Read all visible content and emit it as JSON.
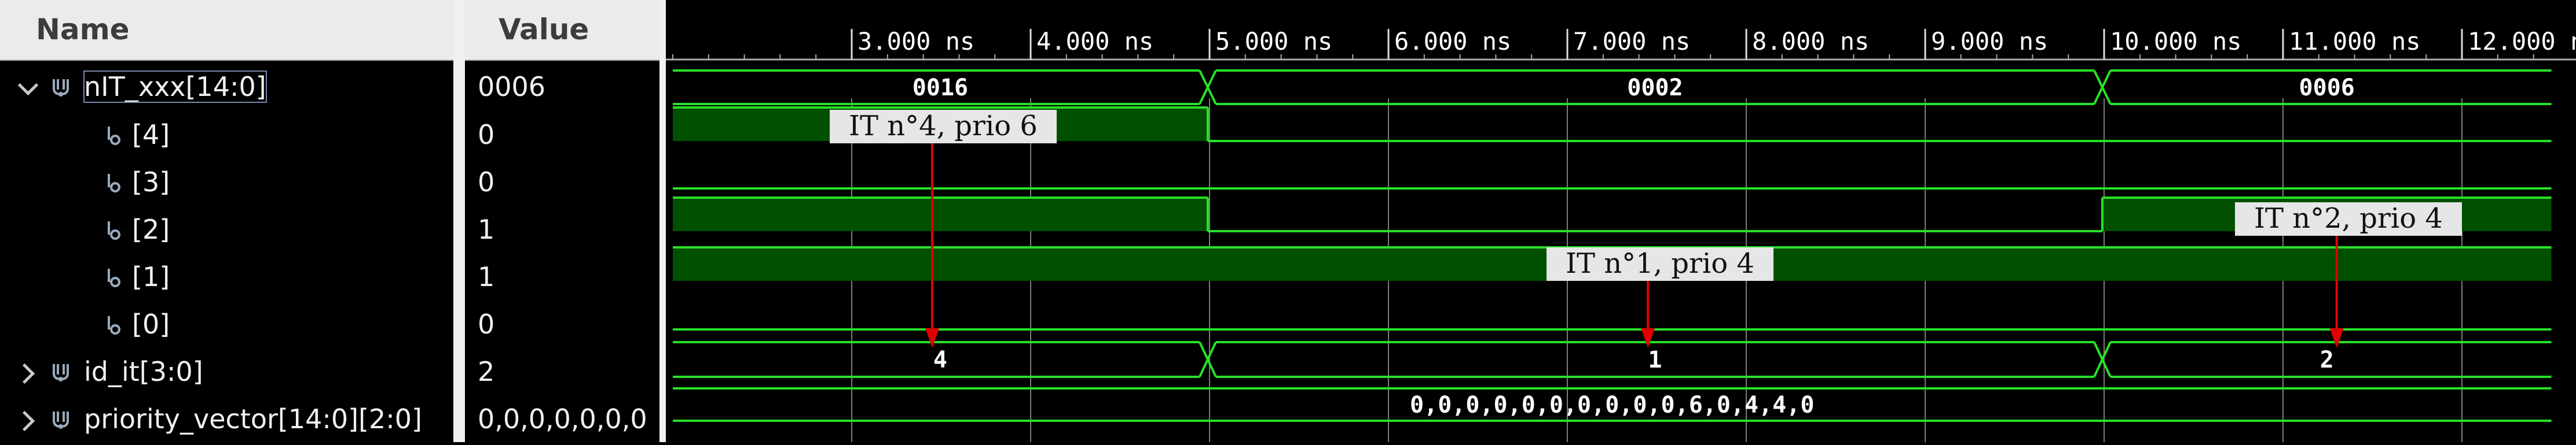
{
  "names_panel": {
    "header": "Name",
    "rows": [
      {
        "label": "nIT_xxx[14:0]",
        "expander": "expanded",
        "icon": "bus-icon"
      },
      {
        "label": "[4]",
        "expander": "none",
        "icon": "signal-icon"
      },
      {
        "label": "[3]",
        "expander": "none",
        "icon": "signal-icon"
      },
      {
        "label": "[2]",
        "expander": "none",
        "icon": "signal-icon"
      },
      {
        "label": "[1]",
        "expander": "none",
        "icon": "signal-icon"
      },
      {
        "label": "[0]",
        "expander": "none",
        "icon": "signal-icon"
      },
      {
        "label": "id_it[3:0]",
        "expander": "collapsed",
        "icon": "bus-icon"
      },
      {
        "label": "priority_vector[14:0][2:0]",
        "expander": "collapsed",
        "icon": "bus-icon"
      }
    ]
  },
  "values_panel": {
    "header": "Value",
    "values": [
      "0006",
      "0",
      "0",
      "1",
      "1",
      "0",
      "2",
      "0,0,0,0,0,0,0"
    ]
  },
  "waveform": {
    "time_unit": "ns",
    "time_range_ns": [
      2.0,
      12.5
    ],
    "tick_labels": [
      "3.000 ns",
      "4.000 ns",
      "5.000 ns",
      "6.000 ns",
      "7.000 ns",
      "8.000 ns",
      "9.000 ns",
      "10.000 ns",
      "11.000 ns",
      "12.000 ns"
    ],
    "tick_values_ns": [
      3,
      4,
      5,
      6,
      7,
      8,
      9,
      10,
      11,
      12
    ],
    "signals": [
      {
        "name": "nIT_xxx[14:0]",
        "kind": "bus",
        "segments": [
          {
            "start": 2.0,
            "end": 4.99,
            "value": "0016"
          },
          {
            "start": 4.99,
            "end": 9.99,
            "value": "0002"
          },
          {
            "start": 9.99,
            "end": 12.5,
            "value": "0006"
          }
        ]
      },
      {
        "name": "[4]",
        "kind": "bit",
        "segments": [
          {
            "start": 2.0,
            "end": 4.99,
            "value": 1
          },
          {
            "start": 4.99,
            "end": 12.5,
            "value": 0
          }
        ]
      },
      {
        "name": "[3]",
        "kind": "bit",
        "segments": [
          {
            "start": 2.0,
            "end": 12.5,
            "value": 0
          }
        ]
      },
      {
        "name": "[2]",
        "kind": "bit",
        "segments": [
          {
            "start": 2.0,
            "end": 4.99,
            "value": 1
          },
          {
            "start": 4.99,
            "end": 9.99,
            "value": 0
          },
          {
            "start": 9.99,
            "end": 12.5,
            "value": 1
          }
        ]
      },
      {
        "name": "[1]",
        "kind": "bit",
        "segments": [
          {
            "start": 2.0,
            "end": 12.5,
            "value": 1
          }
        ]
      },
      {
        "name": "[0]",
        "kind": "bit",
        "segments": [
          {
            "start": 2.0,
            "end": 12.5,
            "value": 0
          }
        ]
      },
      {
        "name": "id_it[3:0]",
        "kind": "bus",
        "segments": [
          {
            "start": 2.0,
            "end": 4.99,
            "value": "4"
          },
          {
            "start": 4.99,
            "end": 9.99,
            "value": "1"
          },
          {
            "start": 9.99,
            "end": 12.5,
            "value": "2"
          }
        ]
      },
      {
        "name": "priority_vector[14:0][2:0]",
        "kind": "bus",
        "segments": [
          {
            "start": 2.0,
            "end": 12.5,
            "value": "0,0,0,0,0,0,0,0,0,0,6,0,4,4,0"
          }
        ]
      }
    ],
    "annotations": [
      {
        "text": "IT n°4, prio 6",
        "arrow_to_time_ns": 3.45,
        "target_row": 6
      },
      {
        "text": "IT n°1, prio 4",
        "arrow_to_time_ns": 7.45,
        "target_row": 6
      },
      {
        "text": "IT n°2, prio 4",
        "arrow_to_time_ns": 11.3,
        "target_row": 6
      }
    ],
    "colors": {
      "trace": "#28e028",
      "fill": "#005000",
      "grid": "#7d7d7d",
      "annotation_arrow": "#e00000",
      "annotation_bg": "#e6e6e6",
      "label_text": "#ffffff"
    }
  }
}
